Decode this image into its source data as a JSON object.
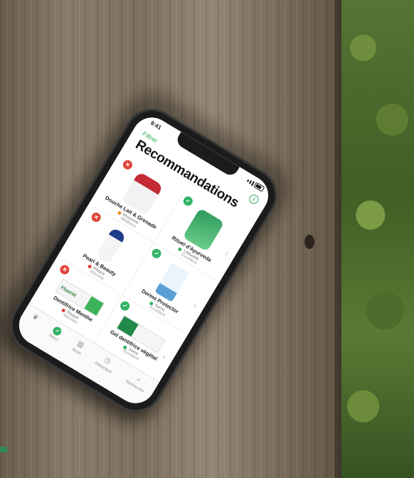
{
  "screen": {
    "status_time": "9:41",
    "filter_label": "Filtrer",
    "info_icon": "i",
    "title": "Recommandations"
  },
  "products": [
    {
      "name": "Douche Lait & Grenade",
      "status": "bad",
      "rating": "Moyenne",
      "detail": "Médiocre",
      "dot_color": "#f08c2a"
    },
    {
      "name": "Rituel d'Ayurveda",
      "status": "good",
      "rating": "Utilisable",
      "detail": "Excellent",
      "dot_color": "#34b465"
    },
    {
      "name": "Pearl & Beauty",
      "status": "bad",
      "rating": "Risque",
      "detail": "Mauvais",
      "dot_color": "#e0433b"
    },
    {
      "name": "Dermo Protector",
      "status": "good",
      "rating": "Saine",
      "detail": "Excellent",
      "dot_color": "#34b465"
    },
    {
      "name": "Dentifrice Menthe",
      "status": "bad",
      "rating": "Risqué",
      "detail": "Mauvais",
      "dot_color": "#e0433b"
    },
    {
      "name": "Gel dentifrice végétal",
      "status": "good",
      "rating": "Saine",
      "detail": "Excellent",
      "dot_color": "#34b465"
    }
  ],
  "product_logo_text": "Fluorid",
  "tabs": [
    "",
    "Reco",
    "Scan",
    "Historique",
    "Recherche"
  ],
  "colors": {
    "accent": "#34b465",
    "alert": "#e0433b"
  }
}
